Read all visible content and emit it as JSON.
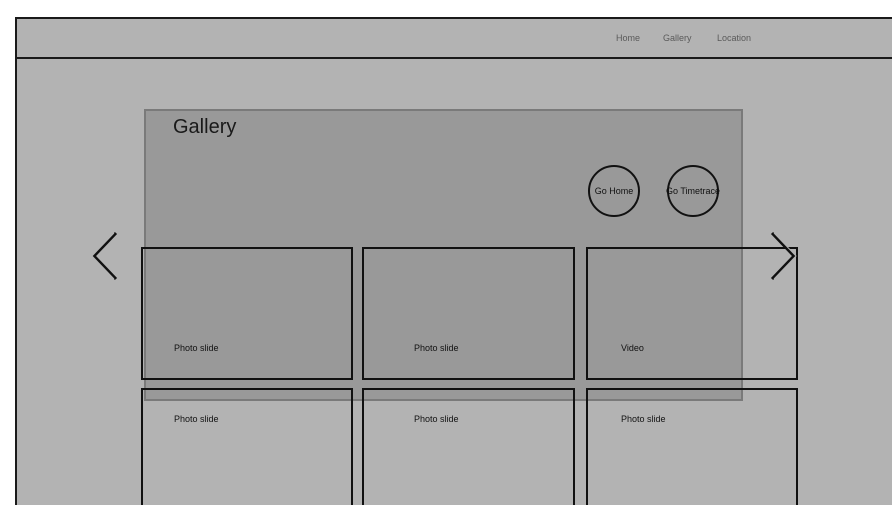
{
  "nav": {
    "items": [
      {
        "label": "Home"
      },
      {
        "label": "Gallery"
      },
      {
        "label": "Location"
      }
    ]
  },
  "gallery": {
    "title": "Gallery",
    "buttons": {
      "go_home": "Go Home",
      "go_timetrace": "Go Timetrace"
    },
    "tiles": [
      {
        "label": "Photo slide"
      },
      {
        "label": "Photo slide"
      },
      {
        "label": "Video"
      },
      {
        "label": "Photo slide"
      },
      {
        "label": "Photo slide"
      },
      {
        "label": "Photo slide"
      }
    ]
  },
  "icons": {
    "previous": "chevron-left-icon",
    "next": "chevron-right-icon"
  }
}
